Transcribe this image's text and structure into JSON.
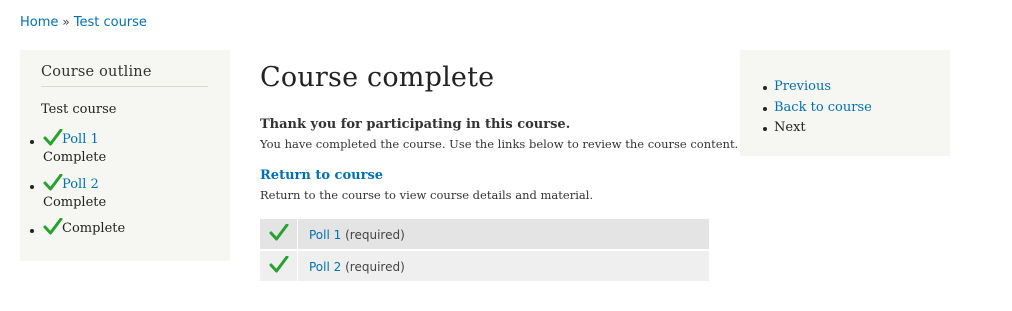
{
  "breadcrumb": {
    "home": "Home",
    "separator": "»",
    "current": "Test course"
  },
  "outline": {
    "title": "Course outline",
    "course_name": "Test course",
    "items": [
      {
        "label": "Poll 1",
        "status": "Complete",
        "icon": "check-icon"
      },
      {
        "label": "Poll 2",
        "status": "Complete",
        "icon": "check-icon"
      },
      {
        "label": "Complete",
        "icon": "check-icon"
      }
    ]
  },
  "main": {
    "title": "Course complete",
    "thanks_heading": "Thank you for participating in this course.",
    "thanks_desc": "You have completed the course. Use the links below to review the course content.",
    "return_link": "Return to course",
    "return_desc": "Return to the course to view course details and material.",
    "requirements": [
      {
        "link": "Poll 1",
        "suffix": "(required)",
        "icon": "check-icon"
      },
      {
        "link": "Poll 2",
        "suffix": "(required)",
        "icon": "check-icon"
      }
    ]
  },
  "nav": {
    "previous": "Previous",
    "back": "Back to course",
    "next": "Next"
  },
  "colors": {
    "link": "#0071b3",
    "check": "#26a22e",
    "sidebar_bg": "#f6f6f2"
  }
}
